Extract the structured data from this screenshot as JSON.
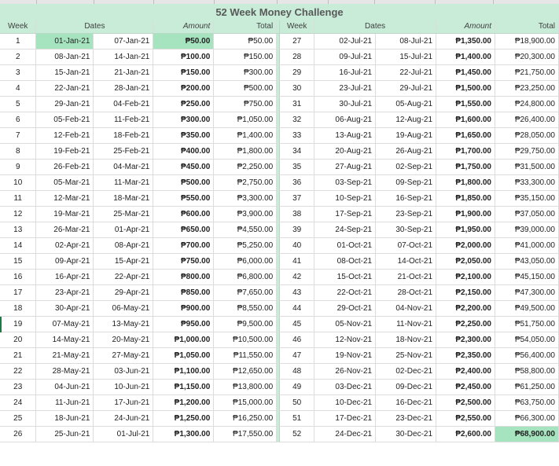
{
  "title": "52 Week Money Challenge",
  "headers": {
    "week": "Week",
    "dates": "Dates",
    "amount": "Amount",
    "total": "Total"
  },
  "weeks": [
    {
      "week": "1",
      "start": "01-Jan-21",
      "end": "07-Jan-21",
      "amount": "₱50.00",
      "total": "₱50.00"
    },
    {
      "week": "2",
      "start": "08-Jan-21",
      "end": "14-Jan-21",
      "amount": "₱100.00",
      "total": "₱150.00"
    },
    {
      "week": "3",
      "start": "15-Jan-21",
      "end": "21-Jan-21",
      "amount": "₱150.00",
      "total": "₱300.00"
    },
    {
      "week": "4",
      "start": "22-Jan-21",
      "end": "28-Jan-21",
      "amount": "₱200.00",
      "total": "₱500.00"
    },
    {
      "week": "5",
      "start": "29-Jan-21",
      "end": "04-Feb-21",
      "amount": "₱250.00",
      "total": "₱750.00"
    },
    {
      "week": "6",
      "start": "05-Feb-21",
      "end": "11-Feb-21",
      "amount": "₱300.00",
      "total": "₱1,050.00"
    },
    {
      "week": "7",
      "start": "12-Feb-21",
      "end": "18-Feb-21",
      "amount": "₱350.00",
      "total": "₱1,400.00"
    },
    {
      "week": "8",
      "start": "19-Feb-21",
      "end": "25-Feb-21",
      "amount": "₱400.00",
      "total": "₱1,800.00"
    },
    {
      "week": "9",
      "start": "26-Feb-21",
      "end": "04-Mar-21",
      "amount": "₱450.00",
      "total": "₱2,250.00"
    },
    {
      "week": "10",
      "start": "05-Mar-21",
      "end": "11-Mar-21",
      "amount": "₱500.00",
      "total": "₱2,750.00"
    },
    {
      "week": "11",
      "start": "12-Mar-21",
      "end": "18-Mar-21",
      "amount": "₱550.00",
      "total": "₱3,300.00"
    },
    {
      "week": "12",
      "start": "19-Mar-21",
      "end": "25-Mar-21",
      "amount": "₱600.00",
      "total": "₱3,900.00"
    },
    {
      "week": "13",
      "start": "26-Mar-21",
      "end": "01-Apr-21",
      "amount": "₱650.00",
      "total": "₱4,550.00"
    },
    {
      "week": "14",
      "start": "02-Apr-21",
      "end": "08-Apr-21",
      "amount": "₱700.00",
      "total": "₱5,250.00"
    },
    {
      "week": "15",
      "start": "09-Apr-21",
      "end": "15-Apr-21",
      "amount": "₱750.00",
      "total": "₱6,000.00"
    },
    {
      "week": "16",
      "start": "16-Apr-21",
      "end": "22-Apr-21",
      "amount": "₱800.00",
      "total": "₱6,800.00"
    },
    {
      "week": "17",
      "start": "23-Apr-21",
      "end": "29-Apr-21",
      "amount": "₱850.00",
      "total": "₱7,650.00"
    },
    {
      "week": "18",
      "start": "30-Apr-21",
      "end": "06-May-21",
      "amount": "₱900.00",
      "total": "₱8,550.00"
    },
    {
      "week": "19",
      "start": "07-May-21",
      "end": "13-May-21",
      "amount": "₱950.00",
      "total": "₱9,500.00"
    },
    {
      "week": "20",
      "start": "14-May-21",
      "end": "20-May-21",
      "amount": "₱1,000.00",
      "total": "₱10,500.00"
    },
    {
      "week": "21",
      "start": "21-May-21",
      "end": "27-May-21",
      "amount": "₱1,050.00",
      "total": "₱11,550.00"
    },
    {
      "week": "22",
      "start": "28-May-21",
      "end": "03-Jun-21",
      "amount": "₱1,100.00",
      "total": "₱12,650.00"
    },
    {
      "week": "23",
      "start": "04-Jun-21",
      "end": "10-Jun-21",
      "amount": "₱1,150.00",
      "total": "₱13,800.00"
    },
    {
      "week": "24",
      "start": "11-Jun-21",
      "end": "17-Jun-21",
      "amount": "₱1,200.00",
      "total": "₱15,000.00"
    },
    {
      "week": "25",
      "start": "18-Jun-21",
      "end": "24-Jun-21",
      "amount": "₱1,250.00",
      "total": "₱16,250.00"
    },
    {
      "week": "26",
      "start": "25-Jun-21",
      "end": "01-Jul-21",
      "amount": "₱1,300.00",
      "total": "₱17,550.00"
    },
    {
      "week": "27",
      "start": "02-Jul-21",
      "end": "08-Jul-21",
      "amount": "₱1,350.00",
      "total": "₱18,900.00"
    },
    {
      "week": "28",
      "start": "09-Jul-21",
      "end": "15-Jul-21",
      "amount": "₱1,400.00",
      "total": "₱20,300.00"
    },
    {
      "week": "29",
      "start": "16-Jul-21",
      "end": "22-Jul-21",
      "amount": "₱1,450.00",
      "total": "₱21,750.00"
    },
    {
      "week": "30",
      "start": "23-Jul-21",
      "end": "29-Jul-21",
      "amount": "₱1,500.00",
      "total": "₱23,250.00"
    },
    {
      "week": "31",
      "start": "30-Jul-21",
      "end": "05-Aug-21",
      "amount": "₱1,550.00",
      "total": "₱24,800.00"
    },
    {
      "week": "32",
      "start": "06-Aug-21",
      "end": "12-Aug-21",
      "amount": "₱1,600.00",
      "total": "₱26,400.00"
    },
    {
      "week": "33",
      "start": "13-Aug-21",
      "end": "19-Aug-21",
      "amount": "₱1,650.00",
      "total": "₱28,050.00"
    },
    {
      "week": "34",
      "start": "20-Aug-21",
      "end": "26-Aug-21",
      "amount": "₱1,700.00",
      "total": "₱29,750.00"
    },
    {
      "week": "35",
      "start": "27-Aug-21",
      "end": "02-Sep-21",
      "amount": "₱1,750.00",
      "total": "₱31,500.00"
    },
    {
      "week": "36",
      "start": "03-Sep-21",
      "end": "09-Sep-21",
      "amount": "₱1,800.00",
      "total": "₱33,300.00"
    },
    {
      "week": "37",
      "start": "10-Sep-21",
      "end": "16-Sep-21",
      "amount": "₱1,850.00",
      "total": "₱35,150.00"
    },
    {
      "week": "38",
      "start": "17-Sep-21",
      "end": "23-Sep-21",
      "amount": "₱1,900.00",
      "total": "₱37,050.00"
    },
    {
      "week": "39",
      "start": "24-Sep-21",
      "end": "30-Sep-21",
      "amount": "₱1,950.00",
      "total": "₱39,000.00"
    },
    {
      "week": "40",
      "start": "01-Oct-21",
      "end": "07-Oct-21",
      "amount": "₱2,000.00",
      "total": "₱41,000.00"
    },
    {
      "week": "41",
      "start": "08-Oct-21",
      "end": "14-Oct-21",
      "amount": "₱2,050.00",
      "total": "₱43,050.00"
    },
    {
      "week": "42",
      "start": "15-Oct-21",
      "end": "21-Oct-21",
      "amount": "₱2,100.00",
      "total": "₱45,150.00"
    },
    {
      "week": "43",
      "start": "22-Oct-21",
      "end": "28-Oct-21",
      "amount": "₱2,150.00",
      "total": "₱47,300.00"
    },
    {
      "week": "44",
      "start": "29-Oct-21",
      "end": "04-Nov-21",
      "amount": "₱2,200.00",
      "total": "₱49,500.00"
    },
    {
      "week": "45",
      "start": "05-Nov-21",
      "end": "11-Nov-21",
      "amount": "₱2,250.00",
      "total": "₱51,750.00"
    },
    {
      "week": "46",
      "start": "12-Nov-21",
      "end": "18-Nov-21",
      "amount": "₱2,300.00",
      "total": "₱54,050.00"
    },
    {
      "week": "47",
      "start": "19-Nov-21",
      "end": "25-Nov-21",
      "amount": "₱2,350.00",
      "total": "₱56,400.00"
    },
    {
      "week": "48",
      "start": "26-Nov-21",
      "end": "02-Dec-21",
      "amount": "₱2,400.00",
      "total": "₱58,800.00"
    },
    {
      "week": "49",
      "start": "03-Dec-21",
      "end": "09-Dec-21",
      "amount": "₱2,450.00",
      "total": "₱61,250.00"
    },
    {
      "week": "50",
      "start": "10-Dec-21",
      "end": "16-Dec-21",
      "amount": "₱2,500.00",
      "total": "₱63,750.00"
    },
    {
      "week": "51",
      "start": "17-Dec-21",
      "end": "23-Dec-21",
      "amount": "₱2,550.00",
      "total": "₱66,300.00"
    },
    {
      "week": "52",
      "start": "24-Dec-21",
      "end": "30-Dec-21",
      "amount": "₱2,600.00",
      "total": "₱68,900.00"
    }
  ],
  "colors": {
    "header_fill": "#c8ecd8",
    "highlight_fill": "#a6e4c0",
    "gridline": "#dcdcdc"
  }
}
